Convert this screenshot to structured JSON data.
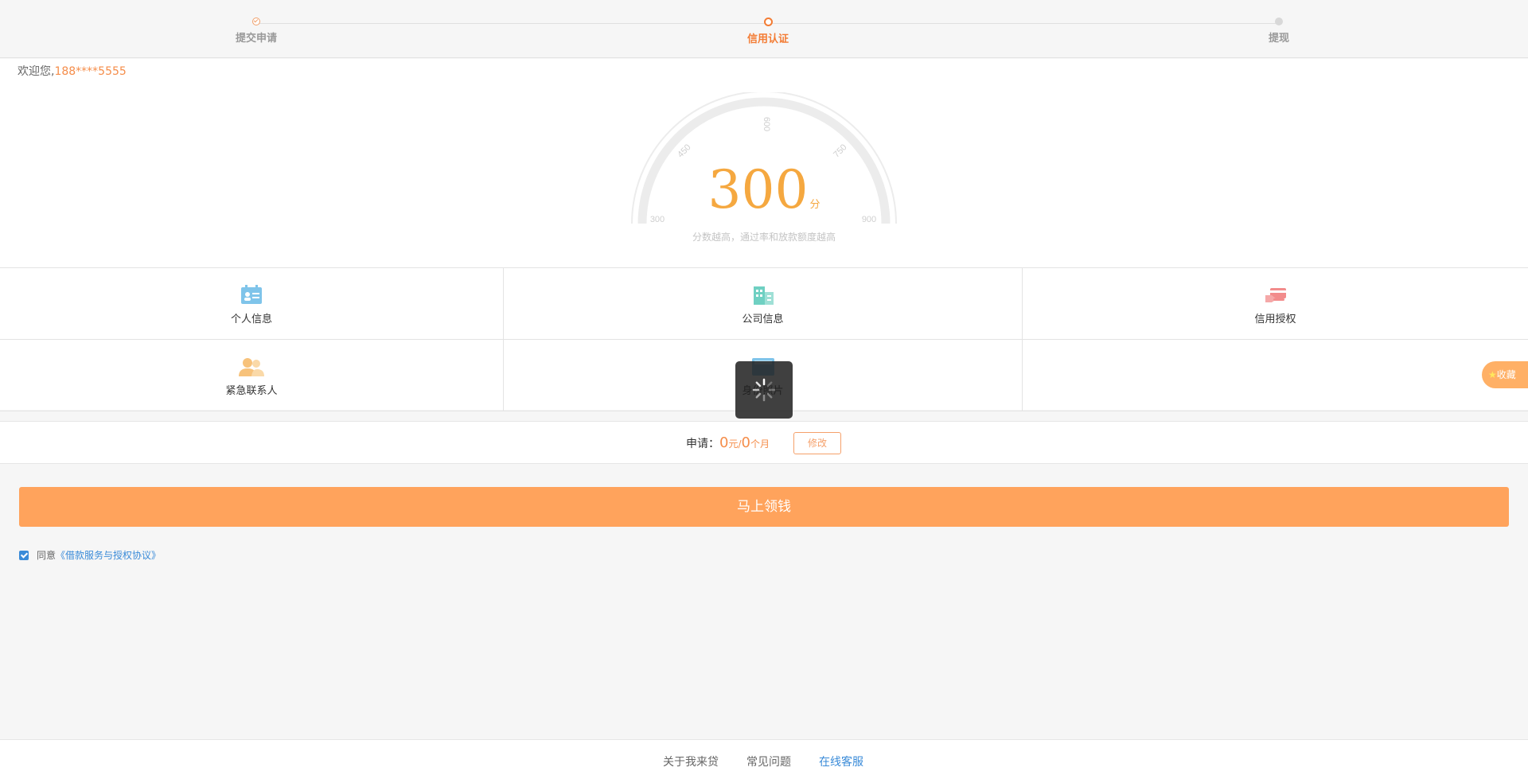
{
  "steps": [
    {
      "label": "提交申请",
      "state": "done"
    },
    {
      "label": "信用认证",
      "state": "current"
    },
    {
      "label": "提现",
      "state": "todo"
    }
  ],
  "welcome": {
    "prefix": "欢迎您,",
    "phone": "188****5555"
  },
  "gauge": {
    "score": 300,
    "unit": "分",
    "min": 300,
    "max": 900,
    "ticks": [
      "300",
      "450",
      "600",
      "750",
      "900"
    ],
    "hint": "分数越高，通过率和放款额度越高"
  },
  "items": [
    {
      "label": "个人信息",
      "icon": "id-card-icon",
      "color": "#7fc4ea"
    },
    {
      "label": "公司信息",
      "icon": "building-icon",
      "color": "#6fd0c2"
    },
    {
      "label": "信用授权",
      "icon": "credit-card-icon",
      "color": "#f28c8c"
    },
    {
      "label": "紧急联系人",
      "icon": "contacts-icon",
      "color": "#f7c27b"
    },
    {
      "label": "身份照片",
      "icon": "photo-icon",
      "color": "#7fc4ea"
    }
  ],
  "apply": {
    "prefix": "申请：",
    "amount": "0",
    "amount_unit": "元",
    "sep": "/",
    "months": "0",
    "months_unit": "个月",
    "modify_label": "修改"
  },
  "cta_label": "马上领钱",
  "agreement": {
    "prefix": "同意",
    "link": "《借款服务与授权协议》",
    "checked": true
  },
  "footer": [
    {
      "label": "关于我来贷"
    },
    {
      "label": "常见问题"
    },
    {
      "label": "在线客服"
    }
  ],
  "collect": {
    "star": "★",
    "label": "收藏"
  },
  "colors": {
    "accent": "#f37c34",
    "cta": "#ffa35c",
    "link": "#3a8bd8",
    "score": "#f5a840"
  }
}
